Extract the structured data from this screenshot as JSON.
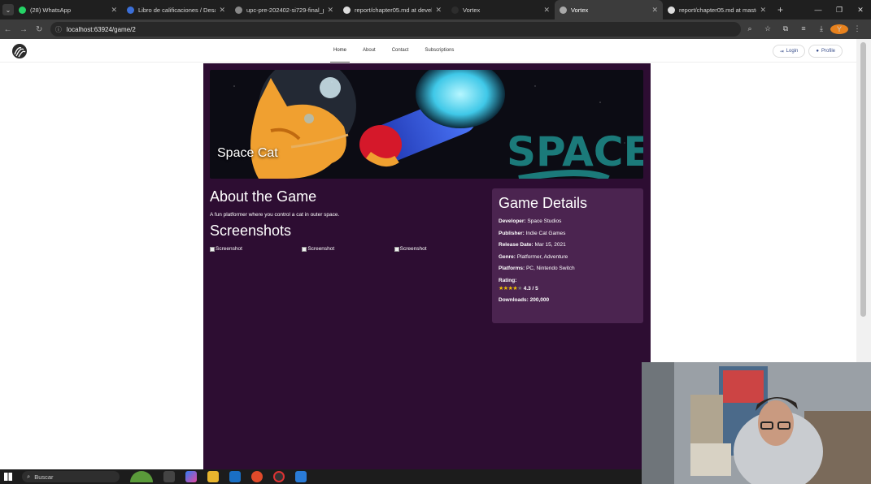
{
  "browser": {
    "tabs": [
      {
        "label": "(28) WhatsApp",
        "fav_color": "#25d366"
      },
      {
        "label": "Libro de calificaciones / Desarr",
        "fav_color": "#3b6fd8"
      },
      {
        "label": "upc-pre-202402-si729-final_pr",
        "fav_color": "#888888"
      },
      {
        "label": "report/chapter05.md at develo",
        "fav_color": "#dddddd"
      },
      {
        "label": "Vortex",
        "fav_color": "#2d2d2d"
      },
      {
        "label": "Vortex",
        "fav_color": "#aaaaaa",
        "active": true
      },
      {
        "label": "report/chapter05.md at maste",
        "fav_color": "#dddddd"
      }
    ],
    "address": "localhost:63924/game/2",
    "profile_initial": "Y"
  },
  "site": {
    "nav": {
      "items": [
        {
          "label": "Home",
          "active": true
        },
        {
          "label": "About"
        },
        {
          "label": "Contact"
        },
        {
          "label": "Subscriptions"
        }
      ],
      "login_label": "Login",
      "profile_label": "Profile"
    },
    "game": {
      "title": "Space Cat",
      "hero_text": "SPACE",
      "about_heading": "About the Game",
      "description": "A fun platformer where you control a cat in outer space.",
      "screenshots_heading": "Screenshots",
      "screenshots": [
        "Screenshot",
        "Screenshot",
        "Screenshot"
      ],
      "details": {
        "heading": "Game Details",
        "developer_label": "Developer:",
        "developer": "Space Studios",
        "publisher_label": "Publisher:",
        "publisher": "Indie Cat Games",
        "release_label": "Release Date:",
        "release": "Mar 15, 2021",
        "genre_label": "Genre:",
        "genre": "Platformer, Adventure",
        "platforms_label": "Platforms:",
        "platforms": "PC, Nintendo Switch",
        "rating_label": "Rating:",
        "rating_value": 4.3,
        "rating_text": "4.3 / 5",
        "downloads_label": "Downloads:",
        "downloads": "200,000"
      }
    }
  },
  "taskbar": {
    "search_label": "Buscar"
  },
  "colors": {
    "panel": "#2d0d32",
    "details_card": "#4b2450",
    "star": "#f2c200"
  }
}
